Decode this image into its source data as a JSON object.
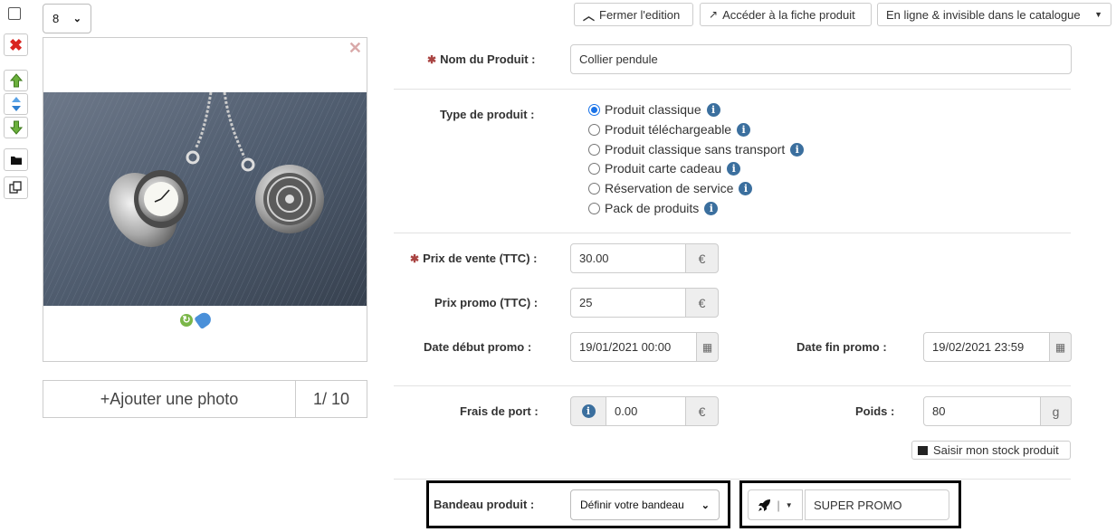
{
  "toolbar": {
    "quantity_select": "8",
    "up_icon": "arrow-up-icon",
    "move_icon": "arrow-updown-icon",
    "down_icon": "arrow-down-icon",
    "folder_icon": "folder-icon",
    "duplicate_icon": "duplicate-icon",
    "delete_icon": "delete-icon"
  },
  "header": {
    "close_edit_label": "Fermer l'edition",
    "product_page_label": "Accéder à la fiche produit",
    "visibility_label": "En ligne & invisible dans le catalogue"
  },
  "photo": {
    "add_label": "+Ajouter une photo",
    "count_label": "1/ 10",
    "colors": {
      "denim": "#4f5c6e",
      "silver": "#c9c9c9"
    }
  },
  "form": {
    "name_label": "Nom du Produit :",
    "name_value": "Collier pendule",
    "type_label": "Type de produit :",
    "types": [
      {
        "label": "Produit classique",
        "checked": true
      },
      {
        "label": "Produit téléchargeable",
        "checked": false
      },
      {
        "label": "Produit classique sans transport",
        "checked": false
      },
      {
        "label": "Produit carte cadeau",
        "checked": false
      },
      {
        "label": "Réservation de service",
        "checked": false
      },
      {
        "label": "Pack de produits",
        "checked": false
      }
    ],
    "price_label": "Prix de vente (TTC) :",
    "price_value": "30.00",
    "promo_label": "Prix promo (TTC) :",
    "promo_value": "25",
    "currency": "€",
    "promo_start_label": "Date début promo :",
    "promo_start_value": "19/01/2021 00:00",
    "promo_end_label": "Date fin promo :",
    "promo_end_value": "19/02/2021 23:59",
    "shipping_label": "Frais de port :",
    "shipping_value": "0.00",
    "weight_label": "Poids :",
    "weight_value": "80",
    "weight_unit": "g",
    "stock_button_label": "Saisir mon stock produit",
    "banner_label": "Bandeau produit :",
    "banner_select": "Définir votre bandeau",
    "banner_text_value": "SUPER PROMO"
  },
  "colors": {
    "required": "#a94442",
    "info": "#3b6f9e",
    "radio_on": "#1a73e8",
    "delete": "#d9241f",
    "arrows": "#5a9a2c"
  }
}
